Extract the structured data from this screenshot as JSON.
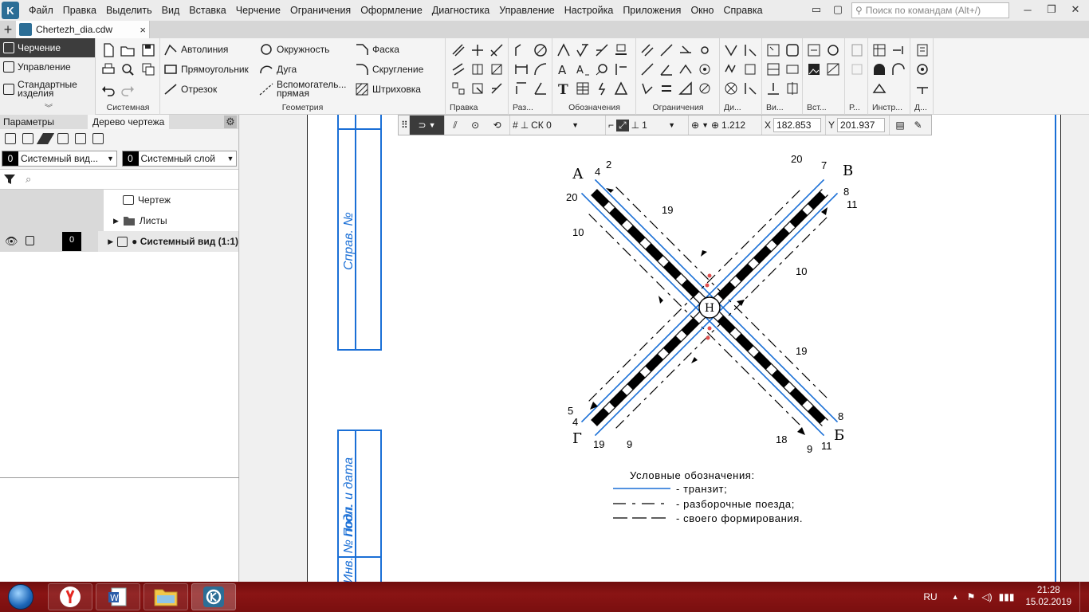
{
  "menubar": {
    "items": [
      "Файл",
      "Правка",
      "Выделить",
      "Вид",
      "Вставка",
      "Черчение",
      "Ограничения",
      "Оформление",
      "Диагностика",
      "Управление",
      "Настройка",
      "Приложения",
      "Окно",
      "Справка"
    ],
    "search_placeholder": "Поиск по командам (Alt+/)"
  },
  "tabs": {
    "document": "Chertezh_dia.cdw",
    "close": "×",
    "add": "+"
  },
  "ribbon": {
    "left": {
      "drawing": "Черчение",
      "management": "Управление",
      "standard_parts": "Стандартные изделия"
    },
    "groups": {
      "system": "Системная",
      "geometry": "Геометрия",
      "edit": "Правка",
      "dim": "Раз...",
      "annotations": "Обозначения",
      "constraints": "Ограничения",
      "di": "Ди...",
      "vi": "Ви...",
      "vst": "Вст...",
      "r": "Р...",
      "instr": "Инстр...",
      "d": "Д..."
    },
    "geometry": {
      "autoline": "Автолиния",
      "rectangle": "Прямоугольник",
      "segment": "Отрезок",
      "circle": "Окружность",
      "arc": "Дуга",
      "aux_line": "Вспомогатель... прямая",
      "chamfer": "Фаска",
      "fillet": "Скругление",
      "hatch": "Штриховка"
    }
  },
  "panel": {
    "tabs": [
      "Параметры",
      "Дерево чертежа"
    ],
    "view_select": {
      "num": "0",
      "text": "Системный вид..."
    },
    "layer_select": {
      "num": "0",
      "text": "Системный слой"
    },
    "tree": {
      "drawing": "Чертеж",
      "sheets": "Листы",
      "system_view": "● Системный вид (1:1)",
      "system_view_layer": "0"
    }
  },
  "canvas_toolbar": {
    "cs": "СК 0",
    "style": "1",
    "zoom": "1.212",
    "x_label": "X",
    "x_value": "182.853",
    "y_label": "Y",
    "y_value": "201.937"
  },
  "stamp": {
    "sprav": "Справ. №",
    "podp": "Подп. и дата",
    "inv": "Инв. № подл."
  },
  "diagram": {
    "stations": {
      "A": "А",
      "V": "В",
      "B": "Б",
      "G": "Г",
      "center": "Н"
    },
    "labels": {
      "a_2": "2",
      "a_4": "4",
      "a_20": "20",
      "a_10": "10",
      "a_19": "19",
      "v_20": "20",
      "v_7": "7",
      "v_8": "8",
      "v_11": "11",
      "v_10": "10",
      "b_19": "19",
      "b_8": "8",
      "b_18": "18",
      "b_9": "9",
      "b_11": "11",
      "g_5": "5",
      "g_4": "4",
      "g_19": "19",
      "g_9": "9"
    },
    "colors": {
      "transit": "#1a6fd6",
      "marker": "#e05050",
      "ink": "#000000"
    },
    "legend": {
      "title": "Условные обозначения:",
      "transit": "- транзит;",
      "dismantling": "- разборочные поезда;",
      "own": "- своего формирования."
    }
  },
  "taskbar": {
    "lang": "RU",
    "time": "21:28",
    "date": "15.02.2019"
  }
}
